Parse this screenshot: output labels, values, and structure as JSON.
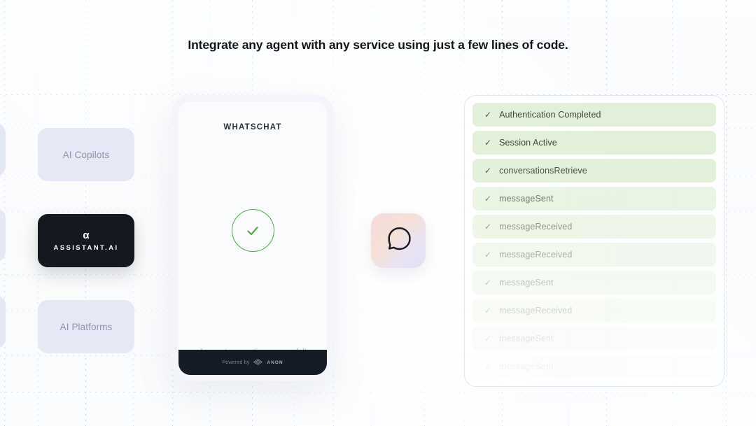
{
  "headline": "Integrate any agent with any service using just a few lines of code.",
  "sidebar": {
    "cards": [
      {
        "label": "AI Copilots"
      },
      {
        "label": "AI Platforms"
      }
    ],
    "assistant": {
      "glyph": "α",
      "name": "ASSISTANT.AI"
    }
  },
  "phone": {
    "title": "WHATSCHAT",
    "status_text": "Account connection successful!",
    "check_icon": "check-circle-icon",
    "footer": {
      "powered_by": "Powered by",
      "brand": "ANON",
      "brand_icon": "anon-diamond-icon"
    }
  },
  "chat_tile": {
    "icon": "chat-bubble-icon"
  },
  "status_panel": {
    "rows": [
      {
        "label": "Authentication Completed",
        "opacity": 1.0
      },
      {
        "label": "Session Active",
        "opacity": 1.0
      },
      {
        "label": "conversationsRetrieve",
        "opacity": 0.95
      },
      {
        "label": "messageSent",
        "opacity": 0.72
      },
      {
        "label": "messageReceived",
        "opacity": 0.58
      },
      {
        "label": "messageReceived",
        "opacity": 0.44
      },
      {
        "label": "messageSent",
        "opacity": 0.33
      },
      {
        "label": "messageReceived",
        "opacity": 0.23
      },
      {
        "label": "messageSent",
        "opacity": 0.14
      },
      {
        "label": "messageSent",
        "opacity": 0.07
      }
    ]
  },
  "colors": {
    "accent_green": "#4caa3f",
    "row_green": "#e2f0d9",
    "dark_card": "#14191f",
    "lavender_card": "#e6e9f5",
    "grid_dot": "#c3cdf0"
  }
}
